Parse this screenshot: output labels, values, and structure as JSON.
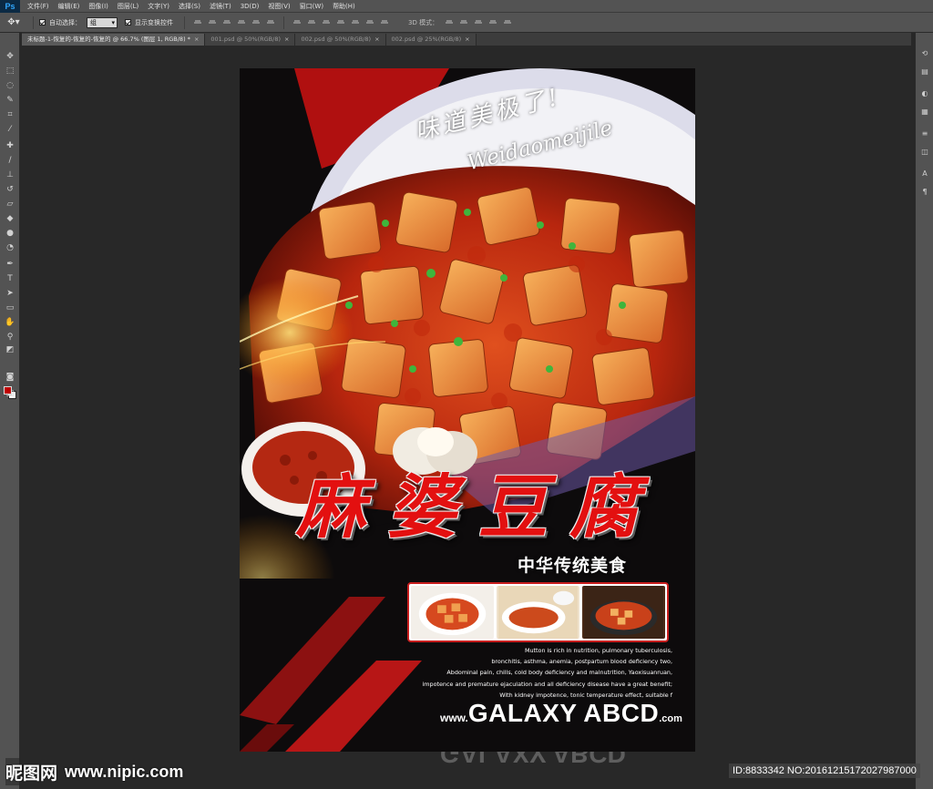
{
  "app": {
    "logo": "Ps",
    "menus": [
      "文件(F)",
      "编辑(E)",
      "图像(I)",
      "图层(L)",
      "文字(Y)",
      "选择(S)",
      "滤镜(T)",
      "3D(D)",
      "视图(V)",
      "窗口(W)",
      "帮助(H)"
    ]
  },
  "options": {
    "auto_select_label": "自动选择：",
    "auto_select_value": "组",
    "show_transform_label": "显示变换控件",
    "mode_3d_label": "3D 模式："
  },
  "tabs": [
    {
      "label": "未标题-1-恢复的-恢复的-恢复的 @ 66.7% (图层 1, RGB/8) *",
      "close": "×",
      "active": true
    },
    {
      "label": "001.psd @ 50%(RGB/8)",
      "close": "×",
      "active": false
    },
    {
      "label": "002.psd @ 50%(RGB/8)",
      "close": "×",
      "active": false
    },
    {
      "label": "002.psd @ 25%(RGB/8)",
      "close": "×",
      "active": false
    }
  ],
  "colors": {
    "foreground": "#c00000",
    "background": "#ffffff",
    "accent_red": "#e31010"
  },
  "poster": {
    "calligraphy": "味道美极了!",
    "calligraphy_pinyin": "Weidaomeijile",
    "title_chars": [
      "麻",
      "婆",
      "豆",
      "腐"
    ],
    "subtitle": "中华传统美食",
    "body_lines": [
      "Mutton is rich in nutrition, pulmonary tuberculosis,",
      "bronchitis, asthma, anemia, postpartum blood deficiency two,",
      "Abdominal pain, chills, cold body deficiency and malnutrition, Yaoxisuanruan,",
      "impotence and premature ejaculation and all deficiency disease have a great benefit;",
      "With kidney impotence, tonic temperature effect, suitable f"
    ],
    "brand_www": "www.",
    "brand_name": "GALAXY ABCD",
    "brand_com": ".com"
  },
  "watermark": {
    "site_logo": "昵图网",
    "site_url": "www.nipic.com",
    "id_text": "ID:8833342 NO:20161215172027987000"
  }
}
